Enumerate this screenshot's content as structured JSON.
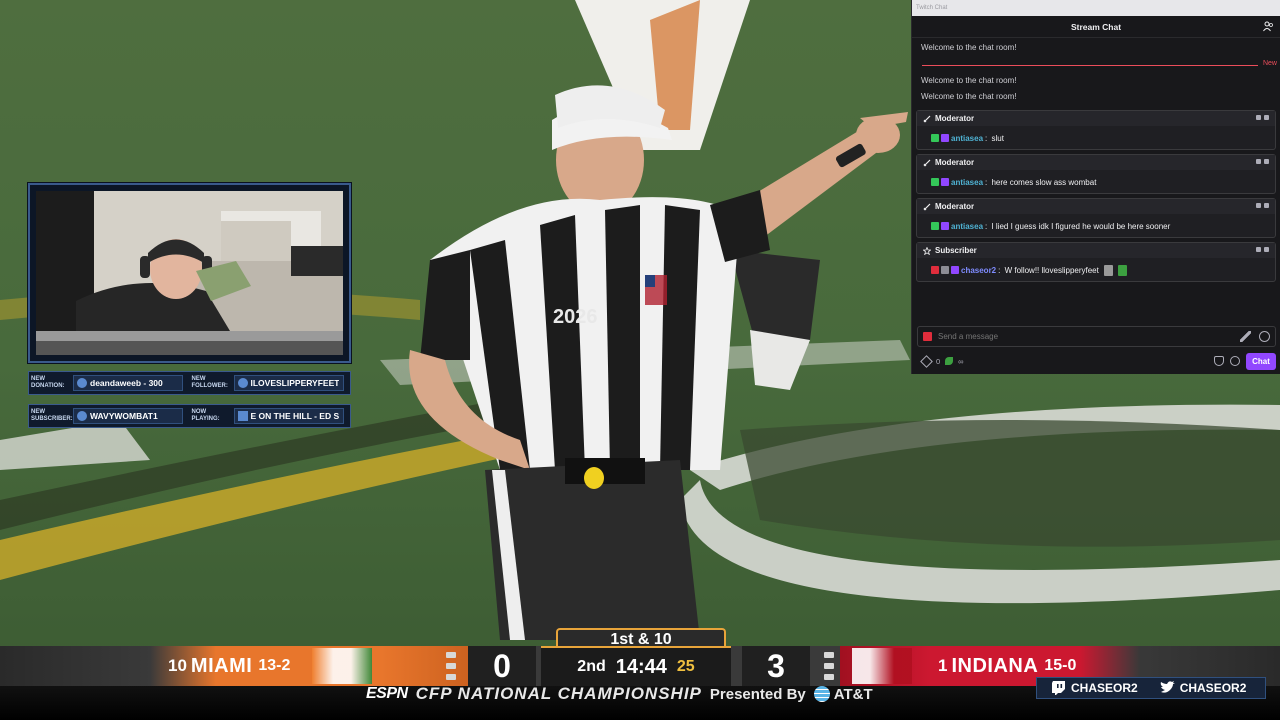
{
  "chat": {
    "window_title": "Twitch Chat",
    "header": "Stream Chat",
    "system_messages": [
      "Welcome to the chat room!",
      "Welcome to the chat room!",
      "Welcome to the chat room!"
    ],
    "new_marker": "New",
    "messages": [
      {
        "role": "Moderator",
        "username": "antiasea",
        "text": "slut"
      },
      {
        "role": "Moderator",
        "username": "antiasea",
        "text": "here comes slow ass wombat"
      },
      {
        "role": "Moderator",
        "username": "antiasea",
        "text": "I lied I guess idk I figured he would be here sooner"
      },
      {
        "role": "Subscriber",
        "username": "chaseor2",
        "text": "W follow!! lloveslipperyfeet"
      }
    ],
    "input_placeholder": "Send a message",
    "points": "0",
    "points_extra": "∞",
    "chat_button": "Chat",
    "colors": {
      "accent": "#9147ff",
      "bg": "#18181b",
      "new_line": "#eb4d5b"
    }
  },
  "stream_overlay": {
    "alerts": [
      {
        "caption": "NEW DONATION:",
        "value": "deandaweeb - 300"
      },
      {
        "caption": "NEW FOLLOWER:",
        "value": "ILOVESLIPPERYFEET"
      },
      {
        "caption": "NEW SUBSCRIBER:",
        "value": "WAVYWOMBAT1"
      },
      {
        "caption": "NOW PLAYING:",
        "value": "E ON THE HILL - ED S"
      }
    ],
    "socials": [
      "CHASEOR2",
      "CHASEOR2"
    ]
  },
  "scorebug": {
    "away": {
      "seed": "10",
      "name": "MIAMI",
      "record": "13-2",
      "score": "0",
      "color": "#e8762c"
    },
    "home": {
      "seed": "1",
      "name": "INDIANA",
      "record": "15-0",
      "score": "3",
      "color": "#cc1830"
    },
    "down": "1st & 10",
    "quarter": "2nd",
    "clock": "14:44",
    "play_clock": "25",
    "network": "ESPN",
    "title": "CFP NATIONAL CHAMPIONSHIP",
    "presented_by": "Presented By",
    "sponsor": "AT&T"
  },
  "video": {
    "jersey_text": "2026"
  }
}
